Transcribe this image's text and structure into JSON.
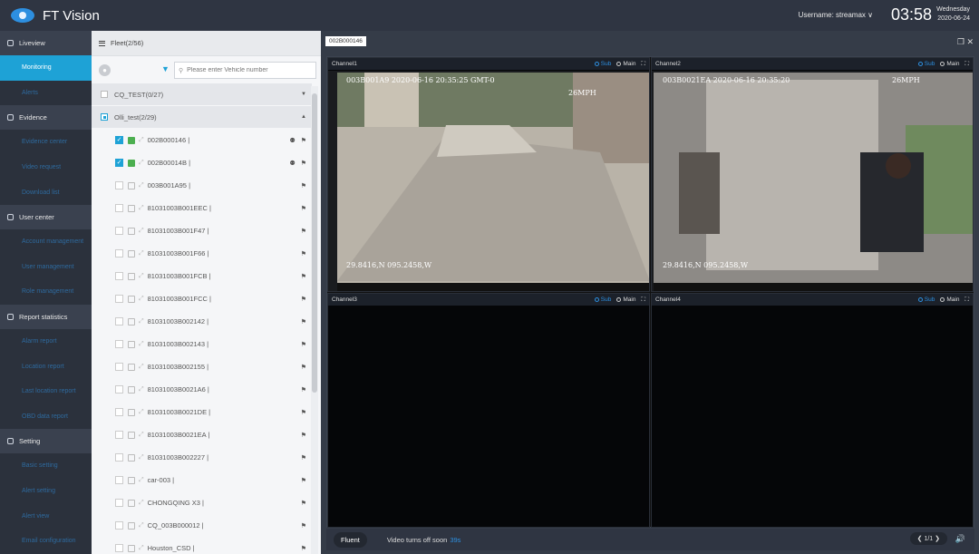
{
  "app": {
    "title": "FT Vision",
    "username": "Username: streamax ∨",
    "time": "03:58",
    "weekday": "Wednesday",
    "date": "2020-06-24"
  },
  "sidebar": [
    {
      "section": "Liveview",
      "items": [
        "Monitoring",
        "Alerts"
      ]
    },
    {
      "section": "Evidence",
      "items": [
        "Evidence center",
        "Video request",
        "Download list"
      ]
    },
    {
      "section": "User center",
      "items": [
        "Account management",
        "User management",
        "Role management"
      ]
    },
    {
      "section": "Report statistics",
      "items": [
        "Alarm report",
        "Location report",
        "Last location report",
        "OBD data report"
      ]
    },
    {
      "section": "Setting",
      "items": [
        "Basic setting",
        "Alert setting",
        "Alert view",
        "Email configuration"
      ]
    }
  ],
  "fleet": {
    "title": "Fleet(2/56)",
    "search_placeholder": "Please enter Vehicle number",
    "groups": [
      {
        "name": "CQ_TEST(0/27)",
        "expanded": false
      },
      {
        "name": "Olli_test(2/29)",
        "expanded": true
      }
    ],
    "vehicles": [
      {
        "name": "002B000146 |",
        "checked": true
      },
      {
        "name": "002B00014B |",
        "checked": true
      },
      {
        "name": "003B001A95 |",
        "checked": false
      },
      {
        "name": "81031003B001EEC |",
        "checked": false
      },
      {
        "name": "81031003B001F47 |",
        "checked": false
      },
      {
        "name": "81031003B001F66 |",
        "checked": false
      },
      {
        "name": "81031003B001FCB |",
        "checked": false
      },
      {
        "name": "81031003B001FCC |",
        "checked": false
      },
      {
        "name": "81031003B002142 |",
        "checked": false
      },
      {
        "name": "81031003B002143 |",
        "checked": false
      },
      {
        "name": "81031003B002155 |",
        "checked": false
      },
      {
        "name": "81031003B0021A6 |",
        "checked": false
      },
      {
        "name": "81031003B0021DE |",
        "checked": false
      },
      {
        "name": "81031003B0021EA |",
        "checked": false
      },
      {
        "name": "81031003B002227 |",
        "checked": false
      },
      {
        "name": "car-003 |",
        "checked": false
      },
      {
        "name": "CHONGQING X3 |",
        "checked": false
      },
      {
        "name": "CQ_003B000012 |",
        "checked": false
      },
      {
        "name": "Houston_CSD |",
        "checked": false
      }
    ]
  },
  "player": {
    "tab": "002B000146",
    "channels": [
      {
        "name": "Channel1",
        "sub": "Sub",
        "main": "Main",
        "osd_top": "003B001A9     2020-06-16 20:35:25 GMT-0",
        "osd_speed": "26MPH",
        "osd_bottom": "29.8416,N 095.2458,W"
      },
      {
        "name": "Channel2",
        "sub": "Sub",
        "main": "Main",
        "osd_top": "003B0021EA   2020-06-16 20:35:20",
        "osd_speed": "26MPH",
        "osd_bottom": "29.8416,N 095.2458,W"
      },
      {
        "name": "Channel3",
        "sub": "Sub",
        "main": "Main"
      },
      {
        "name": "Channel4",
        "sub": "Sub",
        "main": "Main"
      }
    ],
    "mode": "Fluent",
    "notice": "Video turns off soon",
    "countdown": "39s",
    "page": "1/1"
  }
}
